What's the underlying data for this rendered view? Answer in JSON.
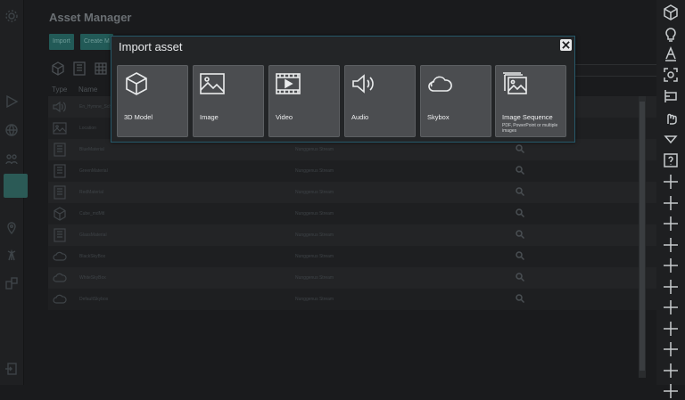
{
  "app": {
    "title": "Asset Manager"
  },
  "toolbar": {
    "import_label": "Import",
    "create_label": "Create M"
  },
  "table": {
    "headers": [
      "Type",
      "Name"
    ],
    "rows": [
      {
        "type": "audio",
        "name": "En_Hymne_Schmit",
        "owner": ""
      },
      {
        "type": "image",
        "name": "Location",
        "owner": ""
      },
      {
        "type": "material",
        "name": "BlueMaterial",
        "owner": "Nunggenus Stream"
      },
      {
        "type": "material",
        "name": "GreenMaterial",
        "owner": "Nunggenus Stream"
      },
      {
        "type": "material",
        "name": "RedMaterial",
        "owner": "Nunggenus Stream"
      },
      {
        "type": "model",
        "name": "Cube_mdMtl",
        "owner": "Nunggenus Stream"
      },
      {
        "type": "material",
        "name": "GlassMaterial",
        "owner": "Nunggenus Stream"
      },
      {
        "type": "skybox",
        "name": "BlackSkyBox",
        "owner": "Nunggenus Stream"
      },
      {
        "type": "skybox",
        "name": "WhiteSkyBox",
        "owner": "Nunggenus Stream"
      },
      {
        "type": "skybox",
        "name": "DefaultSkybox",
        "owner": "Nunggenus Stream"
      }
    ]
  },
  "dialog": {
    "title": "Import asset",
    "tiles": [
      {
        "label": "3D Model",
        "icon": "cube-icon",
        "sub": ""
      },
      {
        "label": "Image",
        "icon": "image-icon",
        "sub": ""
      },
      {
        "label": "Video",
        "icon": "video-icon",
        "sub": ""
      },
      {
        "label": "Audio",
        "icon": "audio-icon",
        "sub": ""
      },
      {
        "label": "Skybox",
        "icon": "cloud-icon",
        "sub": ""
      },
      {
        "label": "Image Sequence",
        "icon": "image-stack-icon",
        "sub": "PDF, PowerPoint or multiple images"
      }
    ]
  },
  "colors": {
    "accent": "#225a57",
    "dialog_border": "#27596a",
    "tile": "#4b4d50"
  }
}
